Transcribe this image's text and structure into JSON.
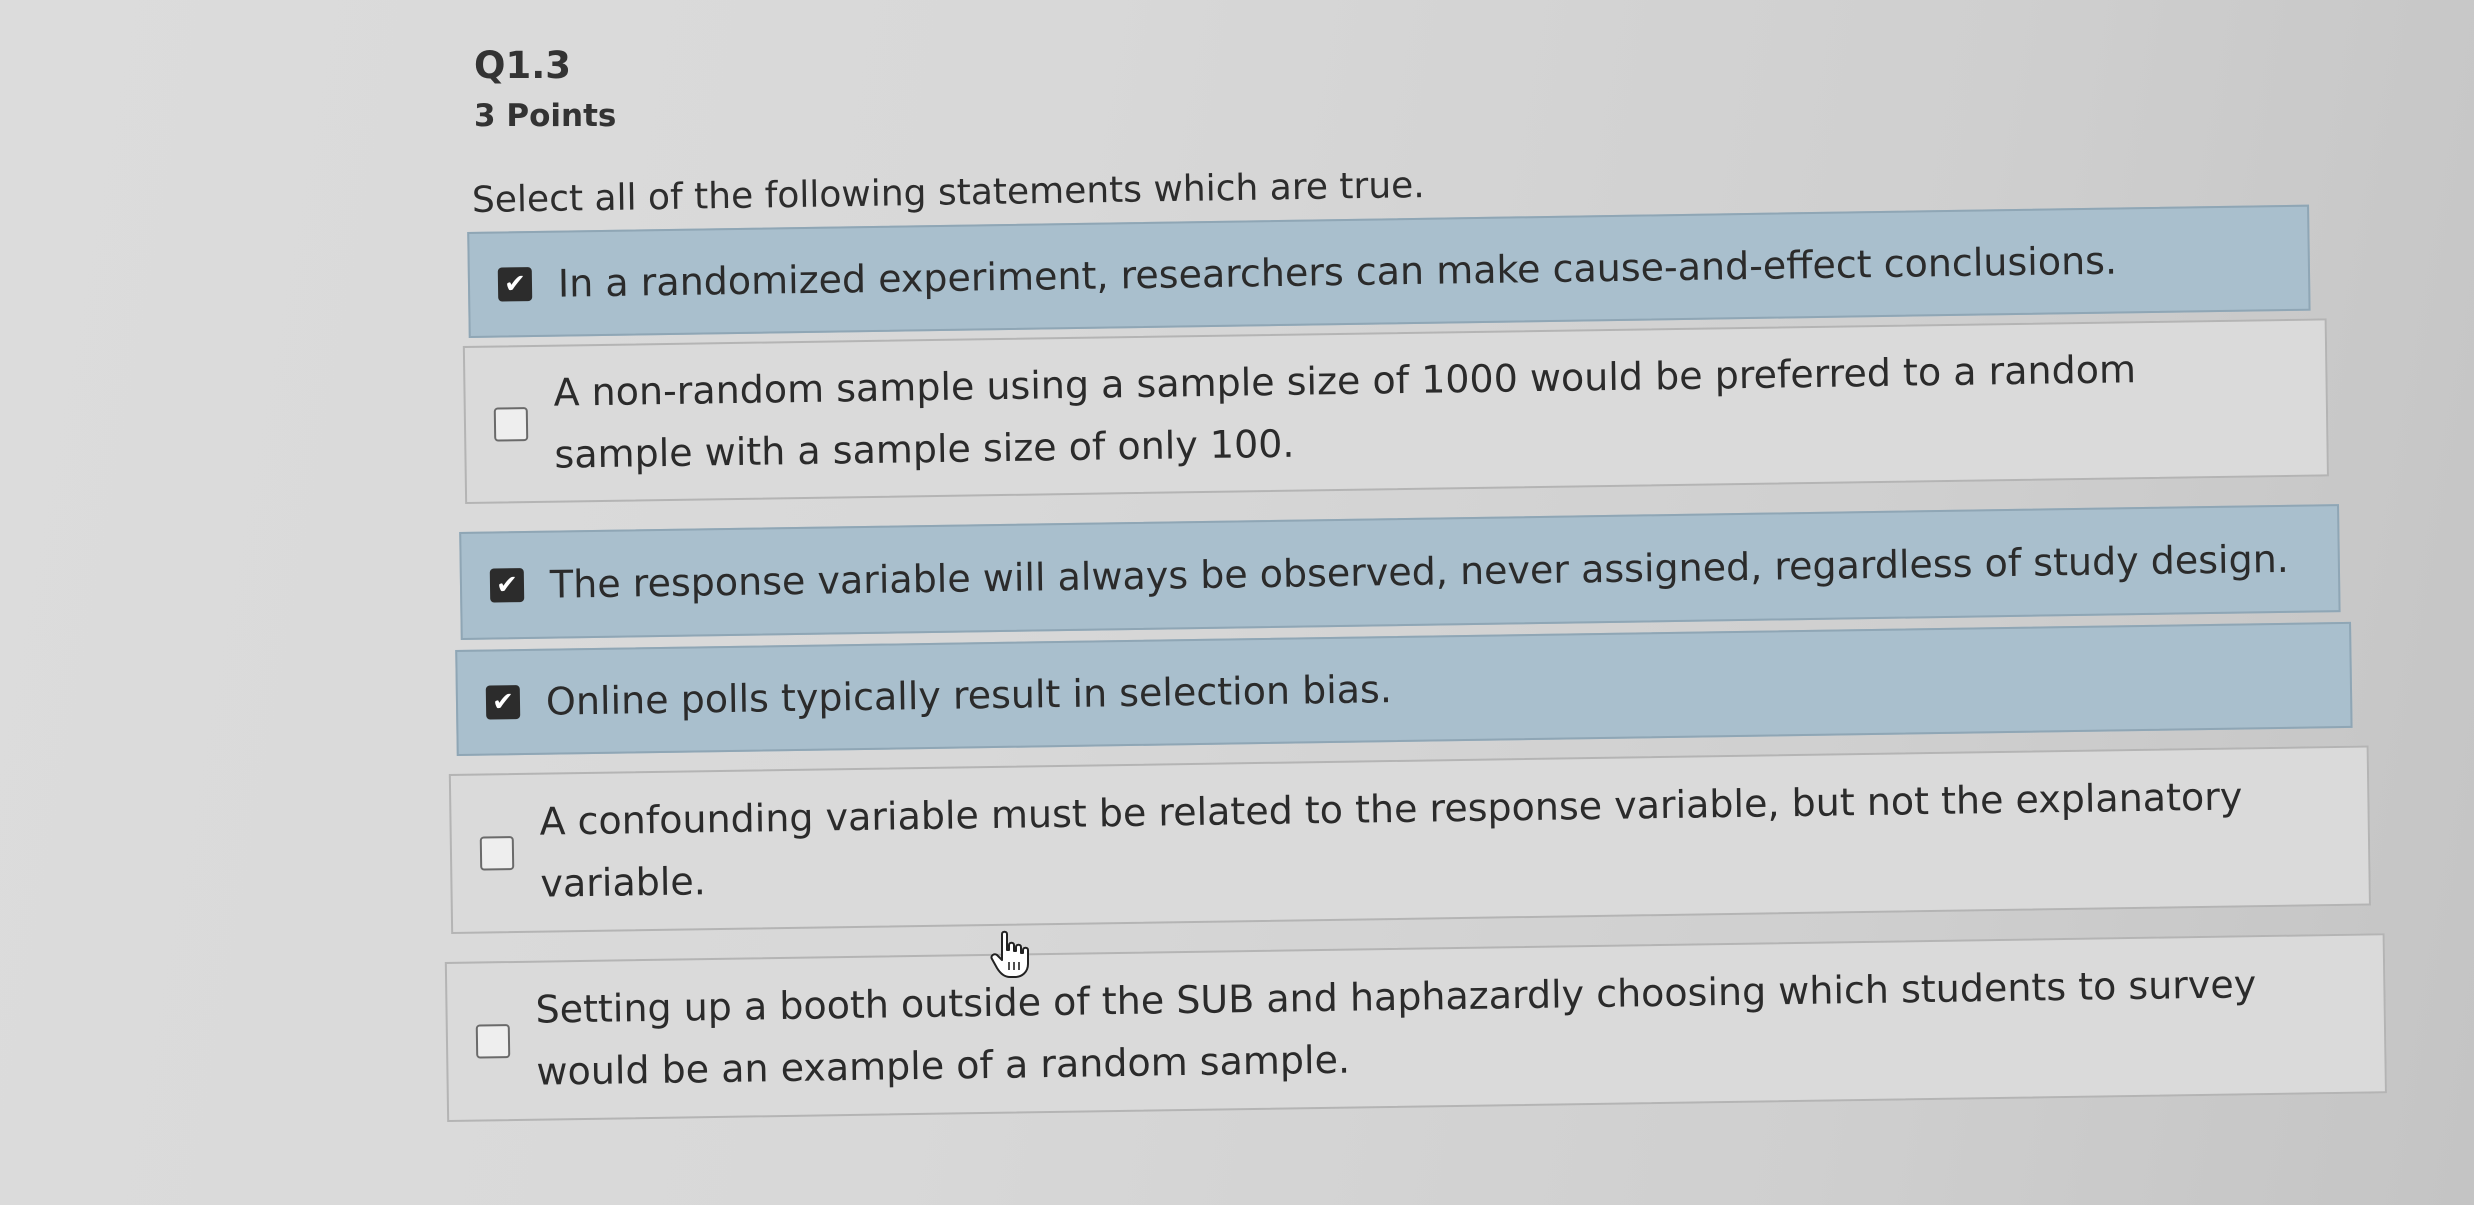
{
  "question": {
    "number": "Q1.3",
    "points": "3 Points",
    "prompt": "Select all of the following statements which are true."
  },
  "choices": [
    {
      "text": "In a randomized experiment, researchers can make cause-and-effect conclusions.",
      "checked": true
    },
    {
      "text": "A non-random sample using a sample size of 1000 would be preferred to a random sample with a sample size of only 100.",
      "checked": false
    },
    {
      "text": "The response variable will always be observed, never assigned, regardless of study design.",
      "checked": true
    },
    {
      "text": "Online polls typically result in selection bias.",
      "checked": true
    },
    {
      "text": "A confounding variable must be related to the response variable, but not the explanatory variable.",
      "checked": false
    },
    {
      "text": "Setting up a booth outside of the SUB and haphazardly choosing which students to survey would be an example of a random sample.",
      "checked": false
    }
  ],
  "icons": {
    "checked": "checkbox-checked-icon",
    "unchecked": "checkbox-empty-icon",
    "cursor": "hand-pointer-icon"
  },
  "colors": {
    "selected_background": "#a9bfcd",
    "unselected_background": "#dadada",
    "checkbox_fill": "#2c2c2c"
  }
}
